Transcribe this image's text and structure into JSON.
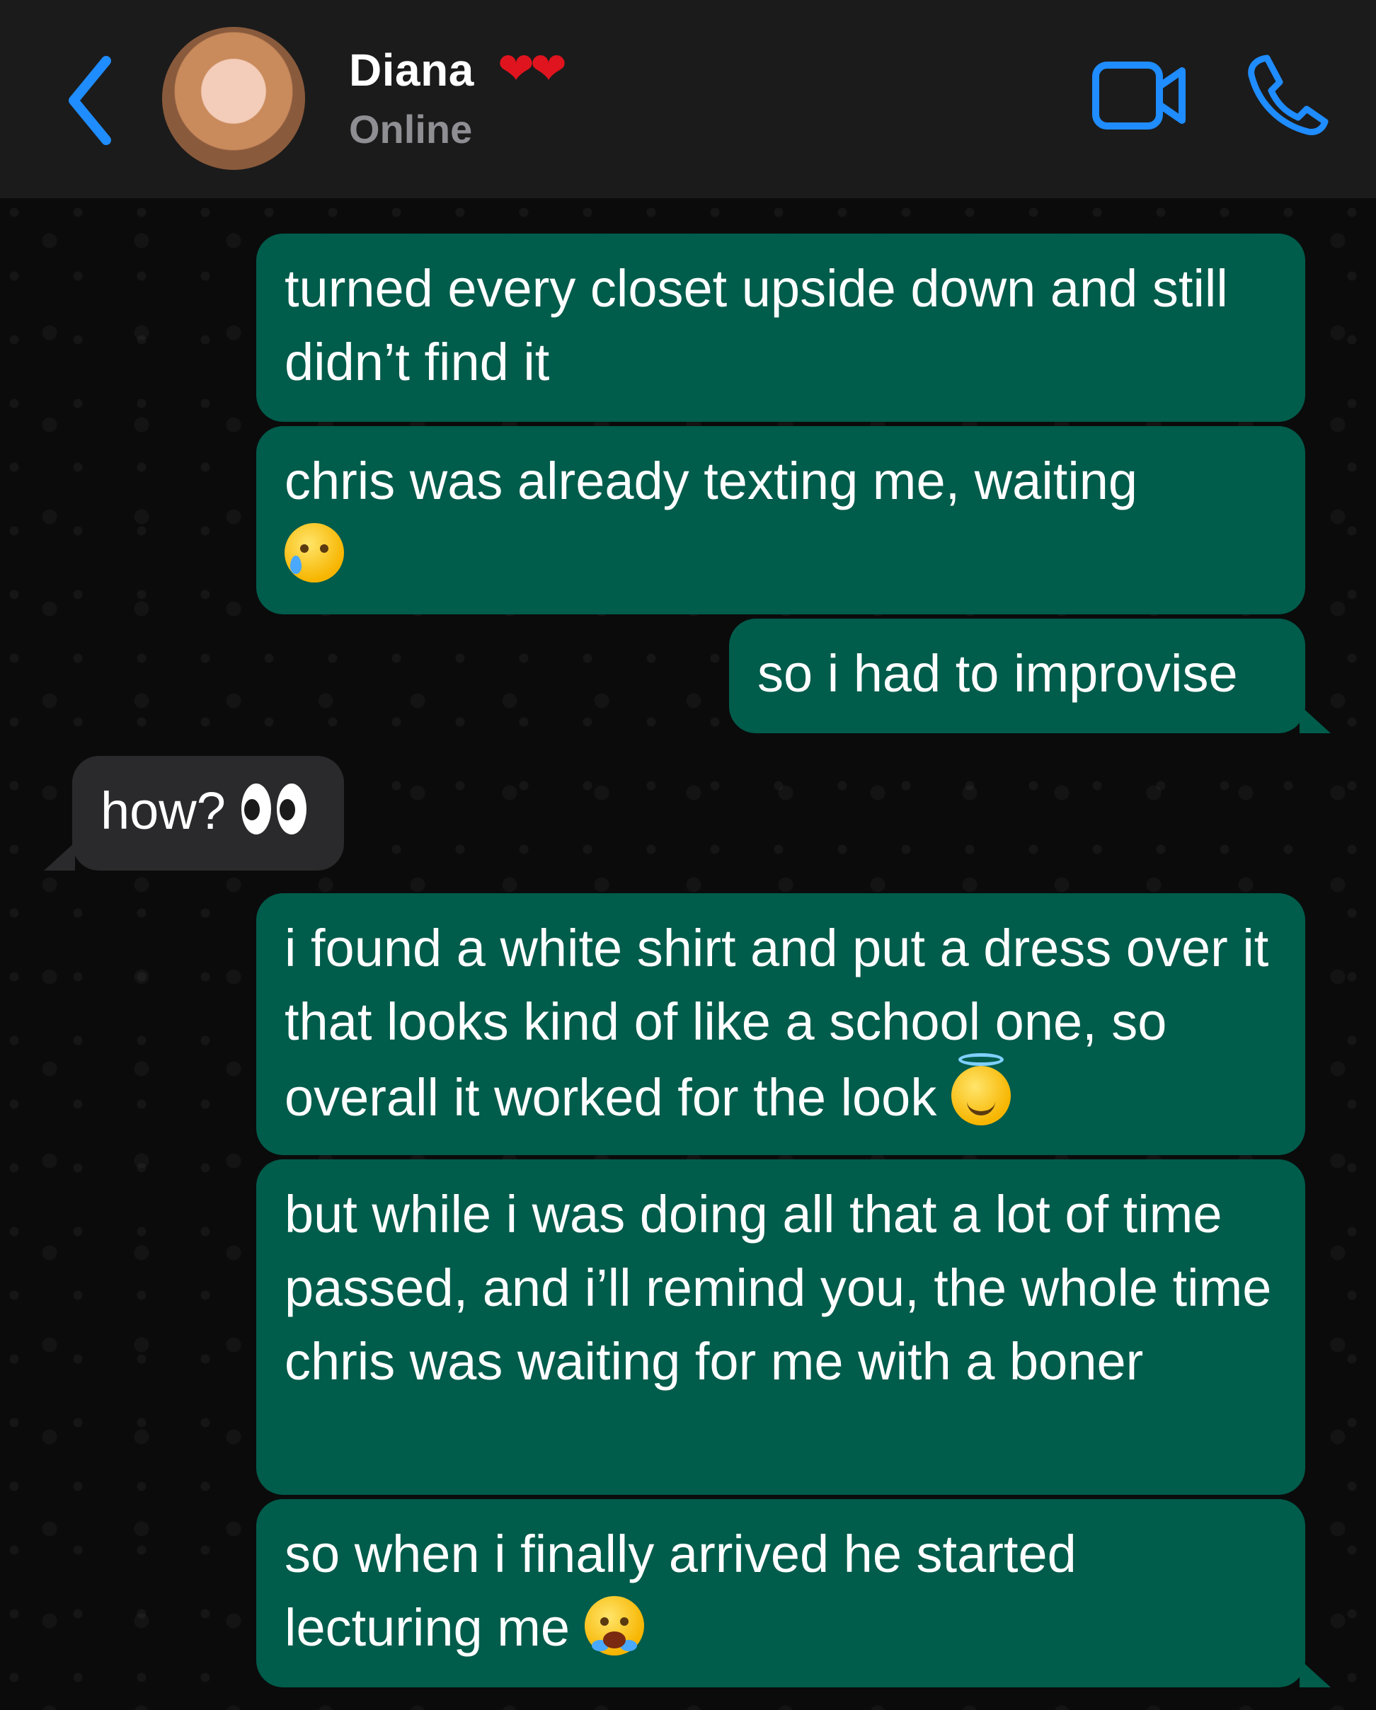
{
  "header": {
    "contact_name": "Diana",
    "name_emoji": "❤❤",
    "status": "Online",
    "accent_color": "#1f8cff"
  },
  "messages": [
    {
      "id": 1,
      "direction": "outgoing",
      "text": "turned every closet upside down and still didn’t find it",
      "emoji": ""
    },
    {
      "id": 2,
      "direction": "outgoing",
      "text": "chris was already texting me, waiting",
      "emoji": "crying-face"
    },
    {
      "id": 3,
      "direction": "outgoing",
      "text": "so i had to improvise",
      "emoji": ""
    },
    {
      "id": 4,
      "direction": "incoming",
      "text": "how?",
      "emoji": "eyes"
    },
    {
      "id": 5,
      "direction": "outgoing",
      "text": "i found a white shirt and put a dress over it that looks kind of like a school one, so overall it worked for the look",
      "emoji": "smiling-face-with-halo"
    },
    {
      "id": 6,
      "direction": "outgoing",
      "text": "but while i was doing all that a lot of time passed, and i’ll remind you, the whole time chris was waiting for me with a boner",
      "emoji": ""
    },
    {
      "id": 7,
      "direction": "outgoing",
      "text": "so when i finally arrived he started lecturing me",
      "emoji": "loudly-crying-face"
    }
  ],
  "colors": {
    "outgoing_bubble": "#005c4b",
    "incoming_bubble": "#2a2a2c",
    "header_bg": "#1b1b1b",
    "chat_bg": "#0b0b0b"
  }
}
